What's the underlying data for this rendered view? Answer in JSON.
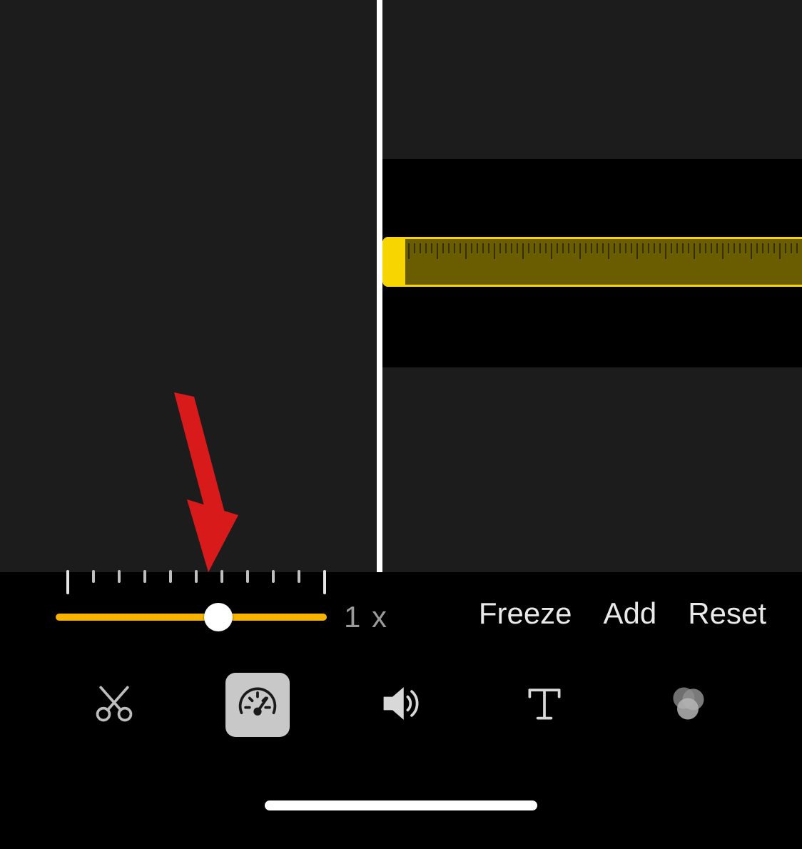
{
  "speed": {
    "value_label": "1 x",
    "slider_percent": 60
  },
  "actions": {
    "freeze": "Freeze",
    "add": "Add",
    "reset": "Reset"
  },
  "toolbar": {
    "items": [
      {
        "name": "trim",
        "icon": "scissors-icon",
        "selected": false
      },
      {
        "name": "speed",
        "icon": "speedometer-icon",
        "selected": true
      },
      {
        "name": "volume",
        "icon": "speaker-icon",
        "selected": false
      },
      {
        "name": "titles",
        "icon": "text-icon",
        "selected": false
      },
      {
        "name": "filters",
        "icon": "filters-icon",
        "selected": false
      }
    ]
  },
  "colors": {
    "accent": "#f6d500",
    "slider": "#f6b400",
    "annotation": "#d81a1a"
  }
}
